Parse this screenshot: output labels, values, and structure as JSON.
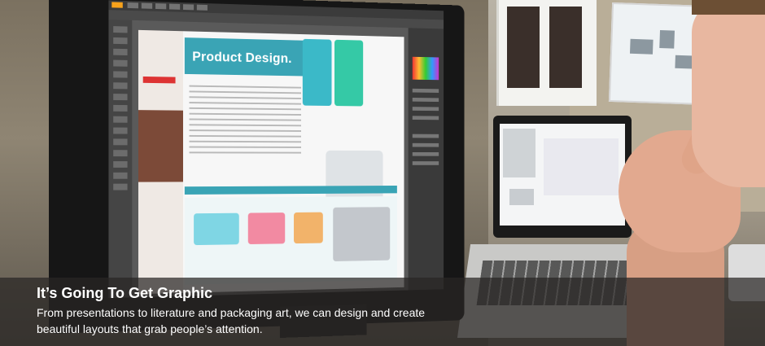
{
  "caption": {
    "title": "It’s Going To Get Graphic",
    "body": "From presentations to literature and packaging art, we can design and create beautiful layouts that grab people’s attention."
  },
  "screen": {
    "headline": "Product Design."
  },
  "colors": {
    "overlay": "#282624",
    "accent_teal": "#3aa4b5",
    "caption_text": "#ffffff"
  }
}
